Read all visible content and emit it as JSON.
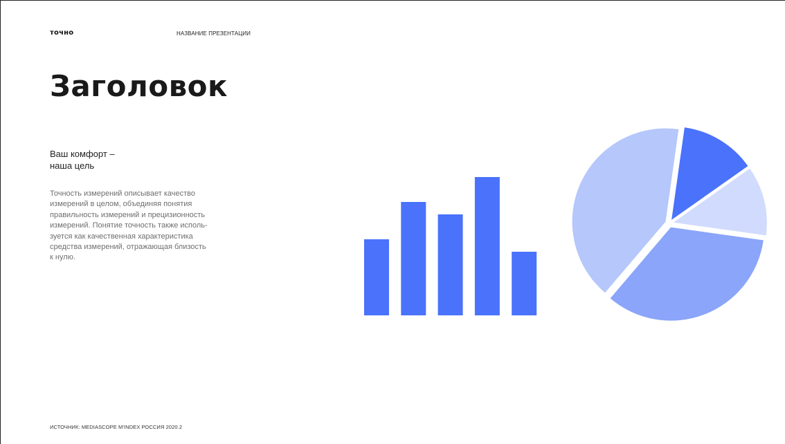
{
  "header": {
    "brand": "точно",
    "presentation_name": "НАЗВАНИЕ ПРЕЗЕНТАЦИИ"
  },
  "title": "Заголовок",
  "subtitle": {
    "lines": [
      "Ваш комфорт –",
      "наша цель"
    ]
  },
  "body": {
    "lines": [
      "Точность измерений описывает качество",
      "измерений в целом, объединяя понятия",
      "правильность измерений и прецизионность",
      "измерений. Понятие точность также исполь-",
      "зуется как качественная характеристика",
      "средства измерений, отражающая близость",
      "к нулю."
    ]
  },
  "footer": {
    "source": "ИСТОЧНИК: MEDIASCOPE M'INDEX РОССИЯ 2020.2"
  },
  "colors": {
    "bar": "#4a72fb",
    "pie": [
      "#8aa5f9",
      "#b5c7fb",
      "#4a72fb",
      "#d0dbfd"
    ]
  },
  "chart_data": [
    {
      "type": "bar",
      "values": [
        55,
        82,
        73,
        100,
        46
      ],
      "ylim": [
        0,
        100
      ]
    },
    {
      "type": "pie",
      "start_angle_deg": 8,
      "values": [
        34,
        41,
        13,
        12
      ]
    }
  ]
}
